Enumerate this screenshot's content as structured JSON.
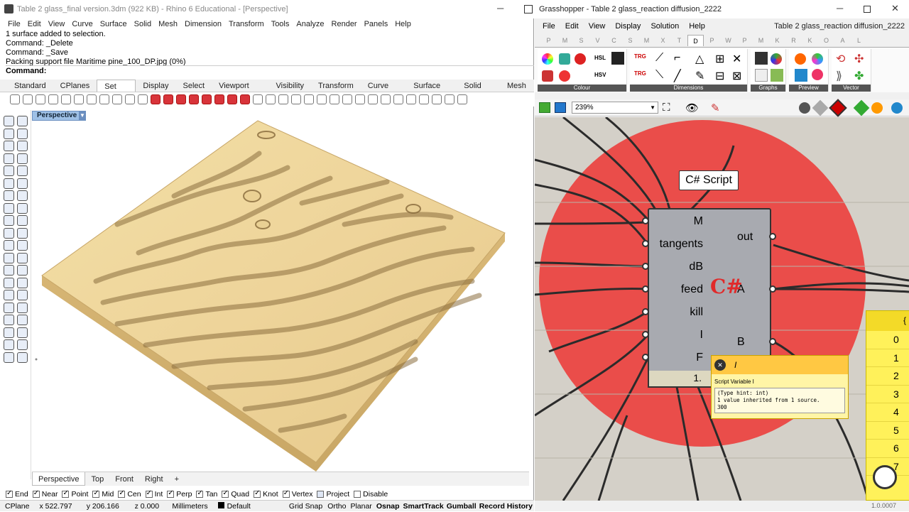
{
  "rhino": {
    "title": "Table 2 glass_final version.3dm (922 KB) - Rhino 6 Educational - [Perspective]",
    "menu": [
      "File",
      "Edit",
      "View",
      "Curve",
      "Surface",
      "Solid",
      "Mesh",
      "Dimension",
      "Transform",
      "Tools",
      "Analyze",
      "Render",
      "Panels",
      "Help"
    ],
    "command_history": [
      "1 surface added to selection.",
      "Command: _Delete",
      "Command: _Save",
      "Packing support file Maritime pine_100_DP.jpg (0%)"
    ],
    "command_prompt": "Command:",
    "toolbar_tabs": [
      "Standard",
      "CPlanes",
      "Set View",
      "Display",
      "Select",
      "Viewport Layout",
      "Visibility",
      "Transform",
      "Curve Tools",
      "Surface Tools",
      "Solid Tools",
      "Mesh T"
    ],
    "active_toolbar_tab": "Set View",
    "viewport_label": "Perspective",
    "viewport_tabs": [
      "Perspective",
      "Top",
      "Front",
      "Right"
    ],
    "add_tab": "+",
    "osnaps": [
      {
        "label": "End",
        "checked": true
      },
      {
        "label": "Near",
        "checked": true
      },
      {
        "label": "Point",
        "checked": true
      },
      {
        "label": "Mid",
        "checked": true
      },
      {
        "label": "Cen",
        "checked": true
      },
      {
        "label": "Int",
        "checked": true
      },
      {
        "label": "Perp",
        "checked": true
      },
      {
        "label": "Tan",
        "checked": true
      },
      {
        "label": "Quad",
        "checked": true
      },
      {
        "label": "Knot",
        "checked": true
      },
      {
        "label": "Vertex",
        "checked": true
      },
      {
        "label": "Project",
        "checked": false
      },
      {
        "label": "Disable",
        "checked": false
      }
    ],
    "status": {
      "cplane": "CPlane",
      "x": "x 522.797",
      "y": "y 206.166",
      "z": "z 0.000",
      "units": "Millimeters",
      "layer": "Default",
      "grid_snap": "Grid Snap",
      "ortho": "Ortho",
      "planar": "Planar",
      "osnap": "Osnap",
      "smarttrack": "SmartTrack",
      "gumball": "Gumball",
      "record_history": "Record History"
    }
  },
  "gh": {
    "title": "Grasshopper - Table 2 glass_reaction diffusion_2222",
    "menu": [
      "File",
      "Edit",
      "View",
      "Display",
      "Solution",
      "Help"
    ],
    "doc_name": "Table 2 glass_reaction diffusion_2222",
    "tabs": [
      "P",
      "M",
      "S",
      "V",
      "C",
      "S",
      "M",
      "X",
      "T",
      "D",
      "P",
      "W",
      "P",
      "M",
      "K",
      "R",
      "K",
      "O",
      "A",
      "L"
    ],
    "active_tab_index": 9,
    "panels": [
      {
        "label": "Colour",
        "icon_text_1": "HSL",
        "icon_text_2": "HSV"
      },
      {
        "label": "Dimensions",
        "icon_text_1": "TRG",
        "icon_text_2": "TRG"
      },
      {
        "label": "Graphs"
      },
      {
        "label": "Preview"
      },
      {
        "label": "Vector"
      }
    ],
    "zoom": "239%",
    "component": {
      "title": "C# Script",
      "inputs": [
        "M",
        "tangents",
        "dB",
        "feed",
        "kill",
        "I",
        "F"
      ],
      "outputs": [
        "out",
        "A",
        "B"
      ],
      "badge": "C#",
      "footer": "1.",
      "brand_color": "#e02a2a"
    },
    "tooltip": {
      "name": "I",
      "subtitle": "Script Variable I",
      "lines": [
        "(Type hint: int)",
        "1 value inherited from 1 source.",
        "300"
      ]
    },
    "panel_list": [
      "0",
      "1",
      "2",
      "3",
      "4",
      "5",
      "6",
      "7"
    ],
    "panel_header": "{",
    "version": "1.0.0007"
  }
}
